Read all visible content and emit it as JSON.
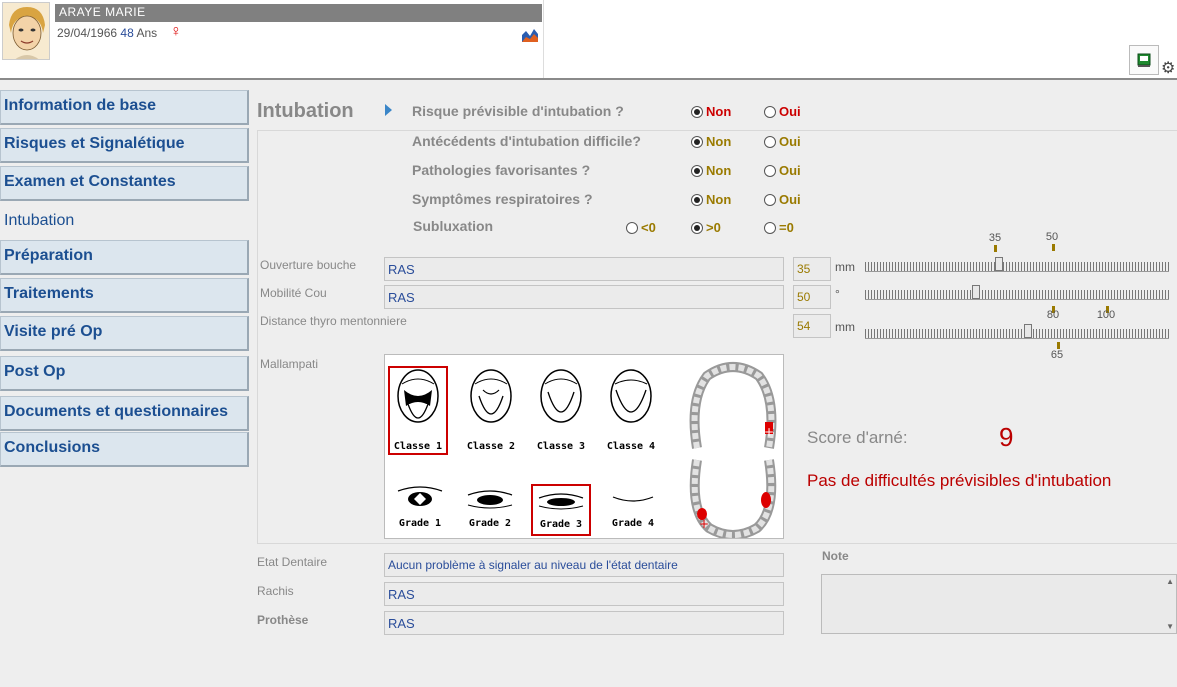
{
  "patient": {
    "name": "ARAYE  MARIE",
    "birthdate": "29/04/1966",
    "age": "48",
    "age_unit": "Ans",
    "sex_symbol": "♀"
  },
  "icons": [
    "avatar",
    "chart-icon",
    "book-icon",
    "gear-icon",
    "female-icon"
  ],
  "nav": [
    {
      "label": "Information de base"
    },
    {
      "label": "Risques et Signalétique"
    },
    {
      "label": "Examen et Constantes"
    },
    {
      "label": "Intubation"
    },
    {
      "label": "Préparation"
    },
    {
      "label": "Traitements"
    },
    {
      "label": "Visite pré Op"
    },
    {
      "label": "Post Op"
    },
    {
      "label": "Documents et questionnaires"
    },
    {
      "label": "Conclusions"
    }
  ],
  "section": {
    "title": "Intubation"
  },
  "questions": [
    {
      "label": "Risque prévisible d'intubation ?",
      "opt1": "Non",
      "opt2": "Oui",
      "selected": "Non"
    },
    {
      "label": "Antécédents d'intubation difficile?",
      "opt1": "Non",
      "opt2": "Oui",
      "selected": "Non"
    },
    {
      "label": "Pathologies favorisantes ?",
      "opt1": "Non",
      "opt2": "Oui",
      "selected": "Non"
    },
    {
      "label": "Symptômes respiratoires ?",
      "opt1": "Non",
      "opt2": "Oui",
      "selected": "Non"
    }
  ],
  "subluxation": {
    "label": "Subluxation",
    "opt1": "<0",
    "opt2": ">0",
    "opt3": "=0",
    "selected": ">0"
  },
  "measures": {
    "ouverture": {
      "label": "Ouverture bouche",
      "text": "RAS",
      "value": "35",
      "unit": "mm",
      "marks": [
        "35",
        "50"
      ],
      "level": 35
    },
    "mobilite": {
      "label": "Mobilité Cou",
      "text": "RAS",
      "value": "50",
      "unit": "°"
    },
    "distance": {
      "label": "Distance thyro mentonniere",
      "value": "54",
      "unit": "mm",
      "marks_top": [
        "80",
        "100"
      ],
      "mark_bottom": "65"
    }
  },
  "mallampati": {
    "label": "Mallampati",
    "classes": [
      "Classe 1",
      "Classe 2",
      "Classe 3",
      "Classe 4"
    ],
    "grades": [
      "Grade 1",
      "Grade 2",
      "Grade 3",
      "Grade 4"
    ],
    "selected_class": "Classe 1",
    "selected_grade": "Grade 3"
  },
  "score": {
    "label": "Score d'arné:",
    "value": "9",
    "verdict": "Pas de difficultés prévisibles d'intubation"
  },
  "fields": {
    "etat_dentaire": {
      "label": "Etat Dentaire",
      "value": "Aucun problème à signaler au niveau de l'état dentaire"
    },
    "rachis": {
      "label": "Rachis",
      "value": "RAS"
    },
    "prothese": {
      "label": "Prothèse",
      "value": "RAS"
    }
  },
  "note": {
    "label": "Note",
    "value": ""
  },
  "colors": {
    "accent": "#1c4f91",
    "red": "#c00000",
    "olive": "#9a7a00"
  }
}
